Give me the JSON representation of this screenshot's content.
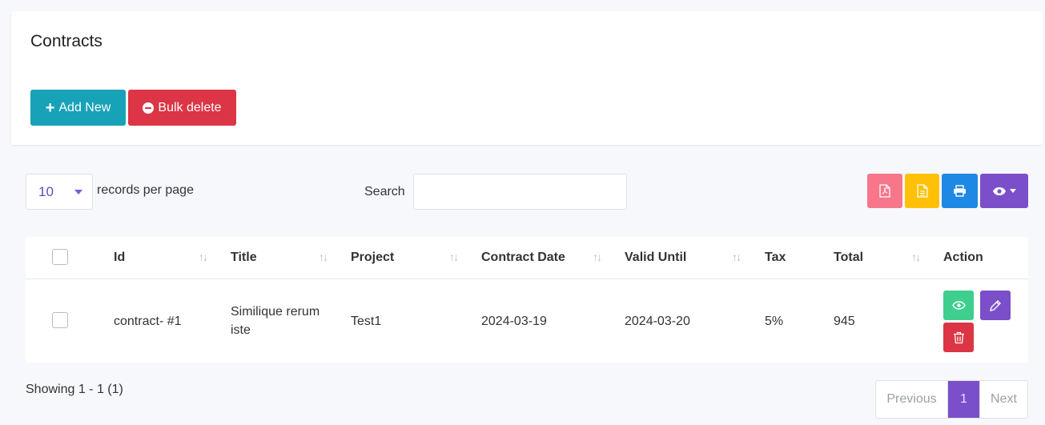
{
  "header": {
    "title": "Contracts",
    "add_label": "Add New",
    "bulk_label": "Bulk delete"
  },
  "toolbar": {
    "per_page_value": "10",
    "per_page_label": "records per page",
    "search_label": "Search",
    "search_value": "",
    "icons": [
      "pdf-icon",
      "csv-icon",
      "print-icon",
      "eye-icon"
    ]
  },
  "table": {
    "columns": [
      "Id",
      "Title",
      "Project",
      "Contract Date",
      "Valid Until",
      "Tax",
      "Total",
      "Action"
    ],
    "rows": [
      {
        "id": "contract- #1",
        "title_line1": "Similique rerum",
        "title_line2": "iste",
        "project": "Test1",
        "contract_date": "2024-03-19",
        "valid_until": "2024-03-20",
        "tax": "5%",
        "total": "945"
      }
    ]
  },
  "footer": {
    "showing": "Showing 1 - 1 (1)",
    "prev": "Previous",
    "page": "1",
    "next": "Next"
  },
  "colors": {
    "add": "#17a2b8",
    "bulk": "#dc3545",
    "pdf": "#f7768a",
    "csv": "#ffc107",
    "print": "#1e88e5",
    "purple": "#7b4fc9",
    "view": "#3ecf8e"
  }
}
